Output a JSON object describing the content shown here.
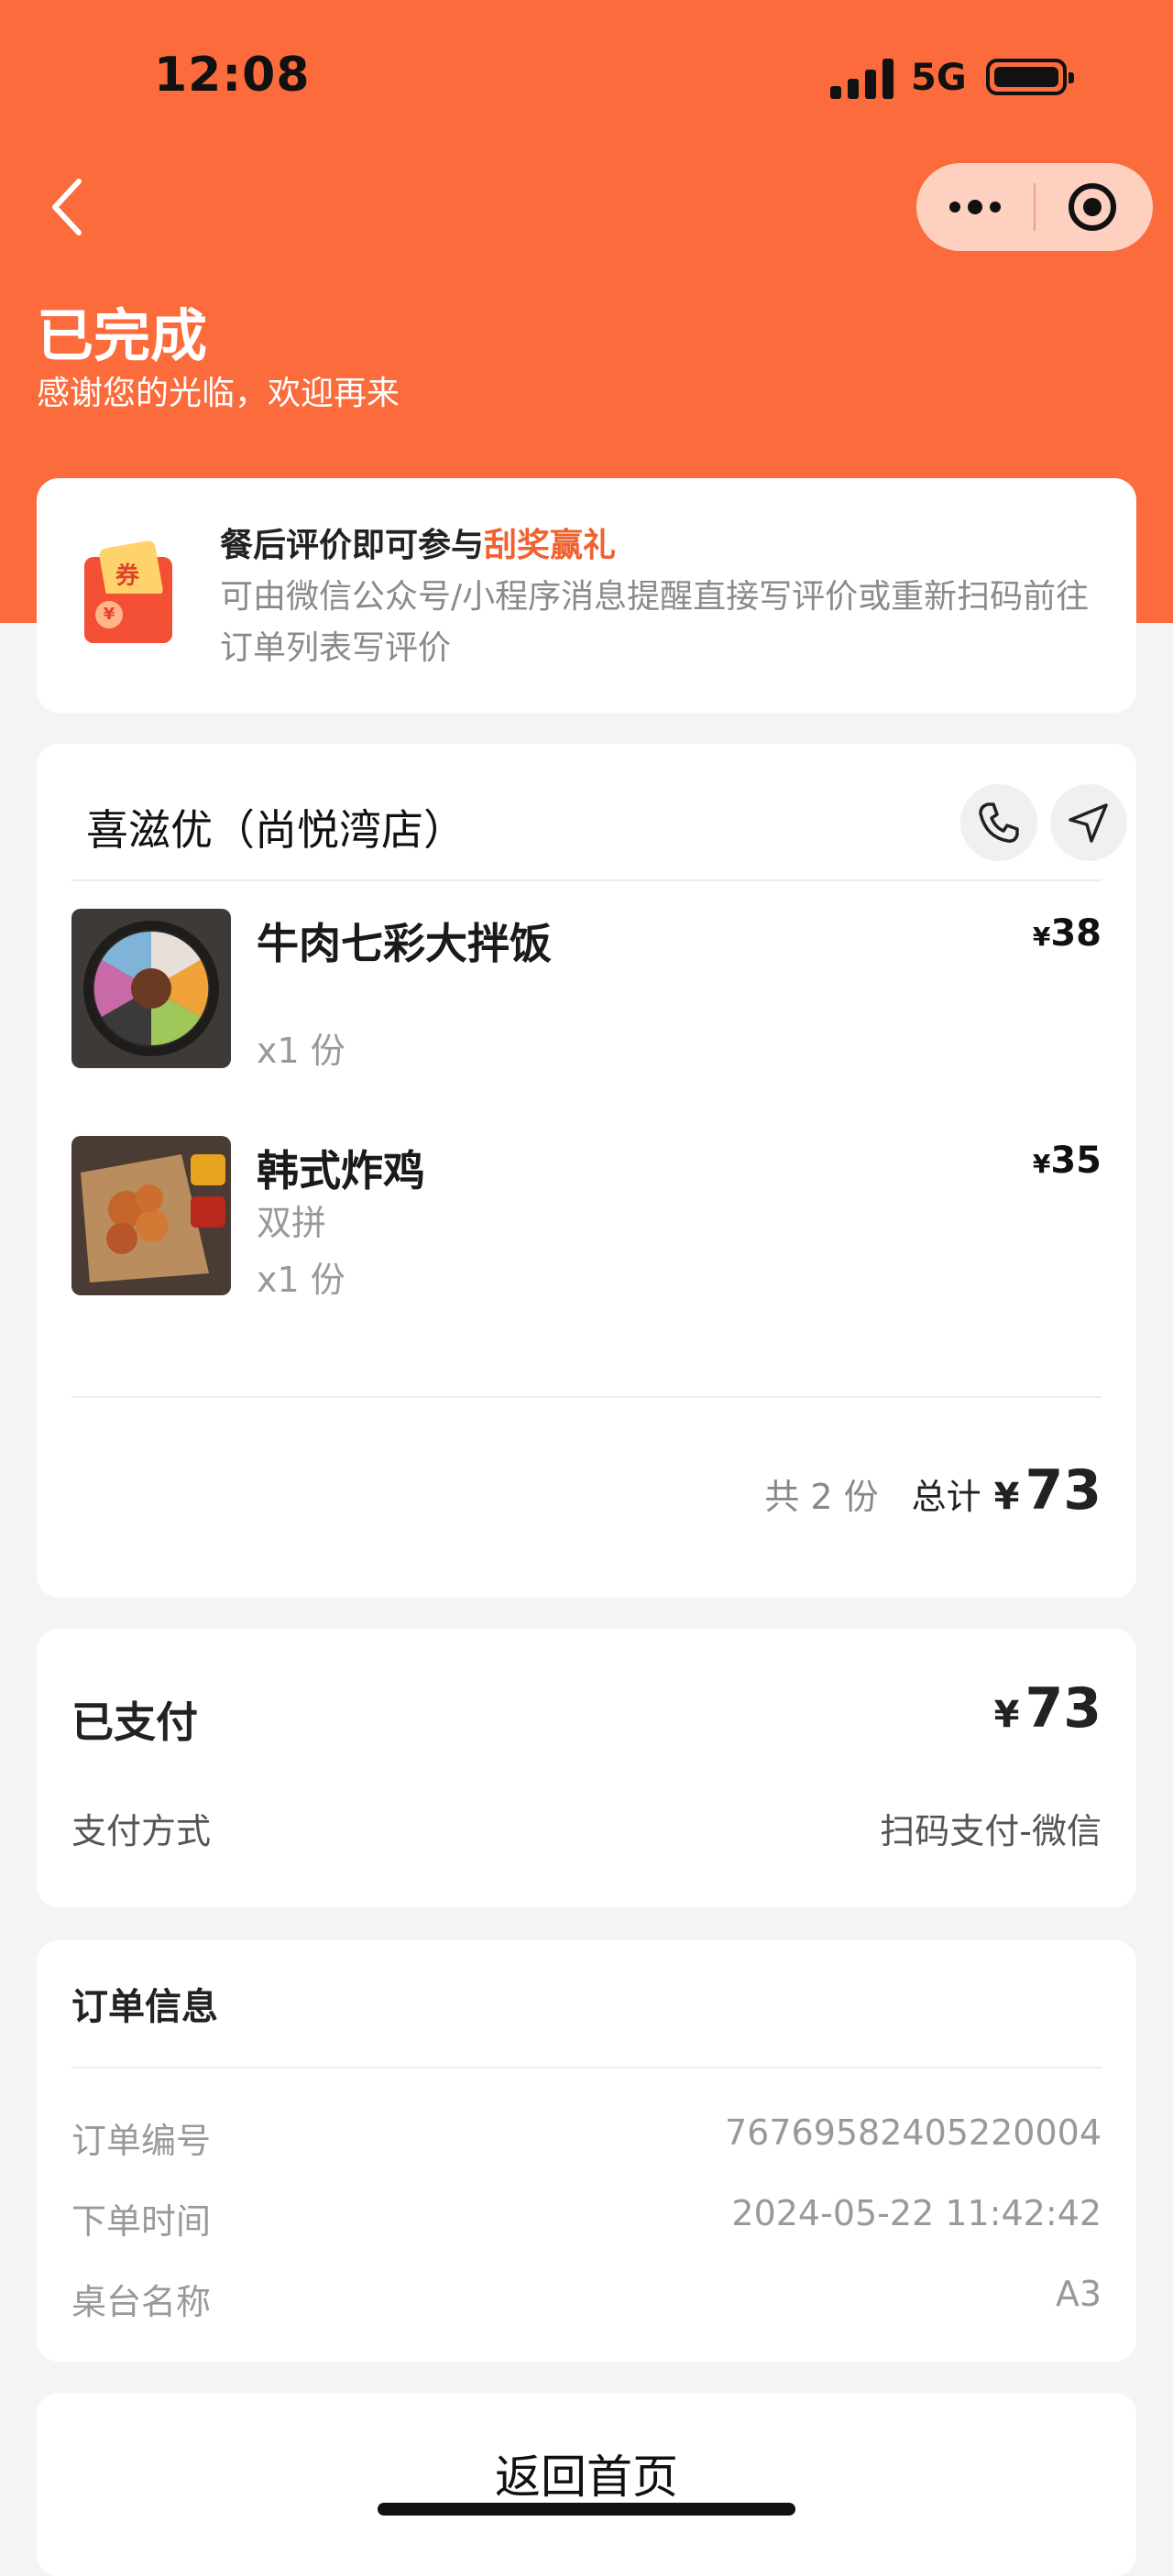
{
  "status_bar": {
    "time": "12:08",
    "network": "5G"
  },
  "header": {
    "title": "已完成",
    "subtitle": "感谢您的光临，欢迎再来",
    "colors": {
      "accent": "#fb6b3b"
    }
  },
  "promo": {
    "icon_text": "券",
    "icon_mark": "¥",
    "title_prefix": "餐后评价即可参与",
    "title_highlight": "刮奖赢礼",
    "description": "可由微信公众号/小程序消息提醒直接写评价或重新扫码前往订单列表写评价"
  },
  "order": {
    "shop_name": "喜滋优（尚悦湾店）",
    "items": [
      {
        "name": "牛肉七彩大拌饭",
        "option": "",
        "quantity": "x1 份",
        "currency": "¥",
        "price": "38"
      },
      {
        "name": "韩式炸鸡",
        "option": "双拼",
        "quantity": "x1 份",
        "currency": "¥",
        "price": "35"
      }
    ],
    "count_text": "共 2 份",
    "total_label": "总计",
    "total_currency": "¥",
    "total": "73"
  },
  "payment": {
    "label": "已支付",
    "currency": "¥",
    "amount": "73",
    "method_label": "支付方式",
    "method_value": "扫码支付-微信"
  },
  "info": {
    "title": "订单信息",
    "rows": [
      {
        "label": "订单编号",
        "value": "76769582405220004"
      },
      {
        "label": "下单时间",
        "value": "2024-05-22 11:42:42"
      },
      {
        "label": "桌台名称",
        "value": "A3"
      }
    ]
  },
  "footer": {
    "home_button": "返回首页"
  }
}
